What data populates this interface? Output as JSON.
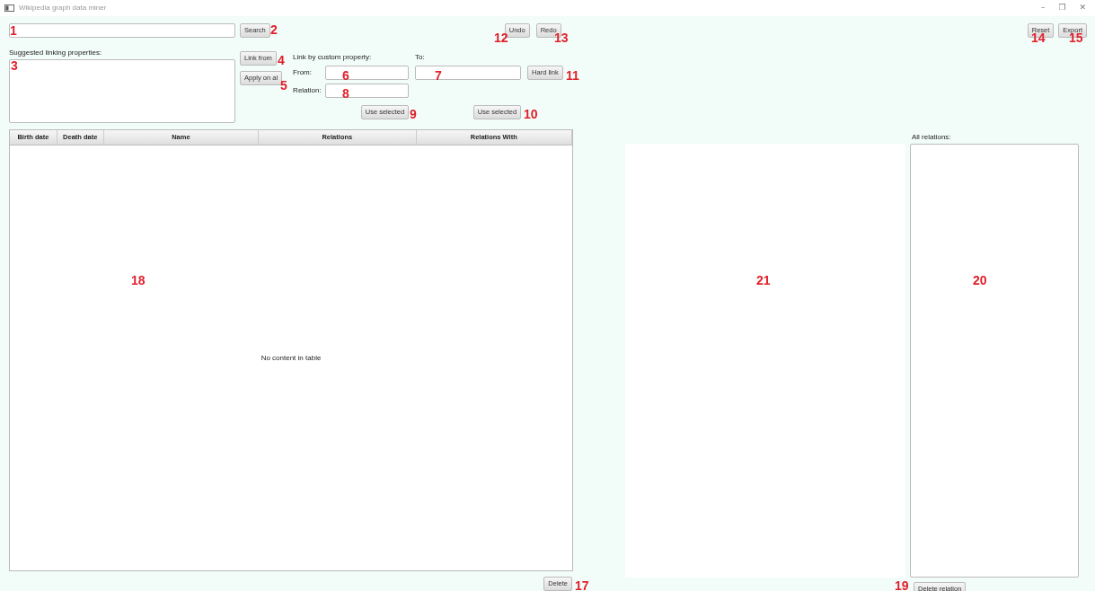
{
  "window": {
    "title": "Wikipedia graph data miner",
    "controls": [
      "–",
      "❐",
      "✕"
    ]
  },
  "search": {
    "button": "Search"
  },
  "history_buttons": [
    "Undo",
    "Redo"
  ],
  "file_buttons": [
    "Reset",
    "Export"
  ],
  "suggested": {
    "label": "Suggested linking properties:"
  },
  "link_buttons": [
    "Link from",
    "Apply on al"
  ],
  "custom": {
    "title": "Link by custom property:",
    "to_label": "To:",
    "from_label": "From:",
    "relation_label": "Relation:",
    "hard_link": "Hard link",
    "use_selected": [
      "Use selected",
      "Use selected"
    ]
  },
  "table": {
    "columns": [
      "Birth date",
      "Death date",
      "Name",
      "Relations",
      "Relations With"
    ],
    "empty_text": "No content in table"
  },
  "delete_button": "Delete",
  "relations": {
    "label": "All relations:",
    "delete_button": "Delete relation"
  },
  "callouts": [
    {
      "label": "1"
    },
    {
      "label": "2"
    },
    {
      "label": "3"
    },
    {
      "label": "4"
    },
    {
      "label": "5"
    },
    {
      "label": "6"
    },
    {
      "label": "7"
    },
    {
      "label": "8"
    },
    {
      "label": "9"
    },
    {
      "label": "10"
    },
    {
      "label": "11"
    },
    {
      "label": "12"
    },
    {
      "label": "13"
    },
    {
      "label": "14"
    },
    {
      "label": "15"
    },
    {
      "label": "17"
    },
    {
      "label": "18"
    },
    {
      "label": "19"
    },
    {
      "label": "21"
    },
    {
      "label": "20"
    }
  ]
}
